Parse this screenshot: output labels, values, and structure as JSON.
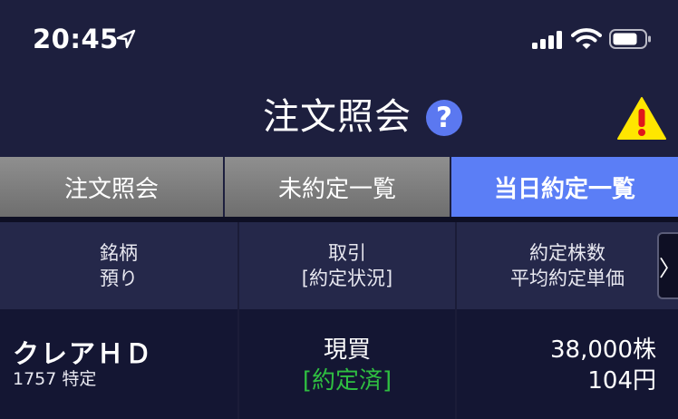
{
  "status_bar": {
    "time": "20:45",
    "icons": [
      "location-arrow-icon",
      "cellular-signal-icon",
      "wifi-icon",
      "battery-icon"
    ]
  },
  "header": {
    "title": "注文照会",
    "help_label": "?",
    "help_icon": "question-circle-icon",
    "warning_icon": "warning-triangle-icon"
  },
  "tabs": [
    {
      "label": "注文照会",
      "active": false
    },
    {
      "label": "未約定一覧",
      "active": false
    },
    {
      "label": "当日約定一覧",
      "active": true
    }
  ],
  "table": {
    "columns": [
      {
        "line1": "銘柄",
        "line2": "預り"
      },
      {
        "line1": "取引",
        "line2": "[約定状況]"
      },
      {
        "line1": "約定株数",
        "line2": "平均約定単価"
      }
    ],
    "scroll_label": "〉",
    "rows": [
      {
        "name": "クレアＨＤ",
        "code_account": "1757 特定",
        "trade": "現買",
        "status": "[約定済]",
        "quantity": "38,000株",
        "avg_price": "104円"
      }
    ]
  },
  "colors": {
    "background": "#1d1f3e",
    "active_tab": "#5b7ef6",
    "inactive_tab": "#7f7f7f",
    "executed_status": "#2fbe41",
    "help_badge": "#5b78f0",
    "warning": "#ffe600"
  }
}
